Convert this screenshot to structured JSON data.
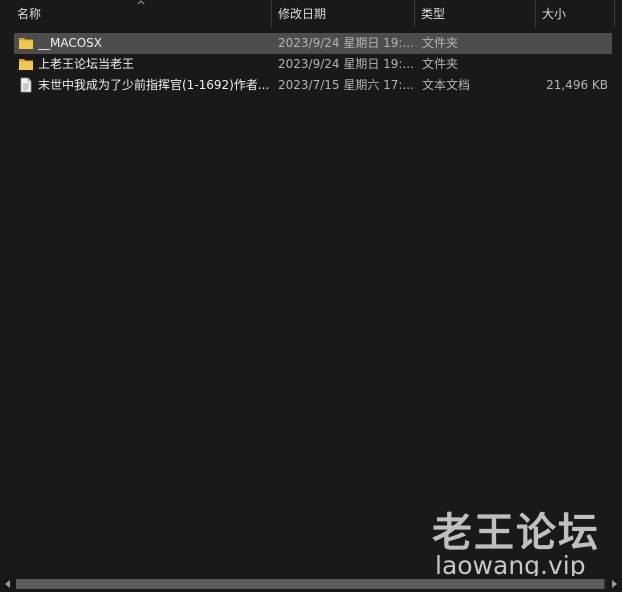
{
  "columns": {
    "name": "名称",
    "date": "修改日期",
    "type": "类型",
    "size": "大小"
  },
  "rows": [
    {
      "icon": "folder-icon",
      "name": "__MACOSX",
      "date": "2023/9/24 星期日 19:...",
      "type": "文件夹",
      "size": "",
      "selected": true
    },
    {
      "icon": "folder-icon",
      "name": "上老王论坛当老王",
      "date": "2023/9/24 星期日 19:...",
      "type": "文件夹",
      "size": ""
    },
    {
      "icon": "text-file-icon",
      "name": "末世中我成为了少前指挥官(1-1692)作者...",
      "date": "2023/7/15 星期六 17:...",
      "type": "文本文档",
      "size": "21,496 KB"
    }
  ],
  "watermark": {
    "title": "老王论坛",
    "url": "laowang.vip"
  },
  "colors": {
    "background": "#191919",
    "selected_row": "#4d4d4d",
    "folder": "#f2c94c",
    "text_primary": "#f0f0f0",
    "text_secondary": "#b4b4b4"
  }
}
